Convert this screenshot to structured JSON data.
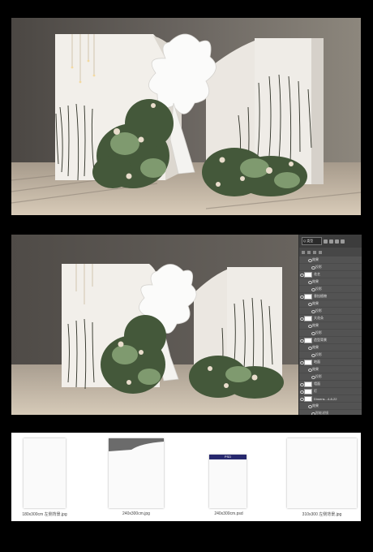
{
  "renders": [
    {
      "label": "Wedding stage rendering"
    },
    {
      "label": "Wedding stage rendering in Photoshop"
    }
  ],
  "layers_panel": {
    "search_text": "Q 类型",
    "rows": [
      {
        "kind": "sub",
        "text": "效果"
      },
      {
        "kind": "subsub",
        "text": "投影"
      },
      {
        "kind": "layer",
        "text": "花艺"
      },
      {
        "kind": "sub",
        "text": "效果"
      },
      {
        "kind": "subsub",
        "text": "投影"
      },
      {
        "kind": "layer",
        "text": "垂挂植物"
      },
      {
        "kind": "sub",
        "text": "效果"
      },
      {
        "kind": "subsub",
        "text": "投影"
      },
      {
        "kind": "layer",
        "text": "大花朵"
      },
      {
        "kind": "sub",
        "text": "效果"
      },
      {
        "kind": "subsub",
        "text": "投影"
      },
      {
        "kind": "layer",
        "text": "造型背景"
      },
      {
        "kind": "sub",
        "text": "效果"
      },
      {
        "kind": "subsub",
        "text": "投影"
      },
      {
        "kind": "layer",
        "text": "地面"
      },
      {
        "kind": "sub",
        "text": "效果"
      },
      {
        "kind": "subsub",
        "text": "投影"
      },
      {
        "kind": "layer",
        "text": "墙面"
      },
      {
        "kind": "layer",
        "text": "灯"
      },
      {
        "kind": "layer",
        "text": "Dimens...4-8-22"
      },
      {
        "kind": "sub",
        "text": "效果"
      },
      {
        "kind": "subsub",
        "text": "智能滤镜"
      },
      {
        "kind": "subsub",
        "text": "高斯"
      }
    ]
  },
  "files": [
    {
      "name": "180x300cm 左侧背景.jpg",
      "thumb": "blank"
    },
    {
      "name": "240x300cm.jpg",
      "thumb": "wave"
    },
    {
      "name": "240x300cm.psd",
      "thumb": "psd",
      "badge": "PSD"
    },
    {
      "name": "310x300 左侧背景.jpg",
      "thumb": "blank"
    }
  ],
  "colors": {
    "wall": "#5e5a55",
    "floor": "#c9bcab",
    "panel_bg": "#535353",
    "psd_badge": "#27286e"
  }
}
